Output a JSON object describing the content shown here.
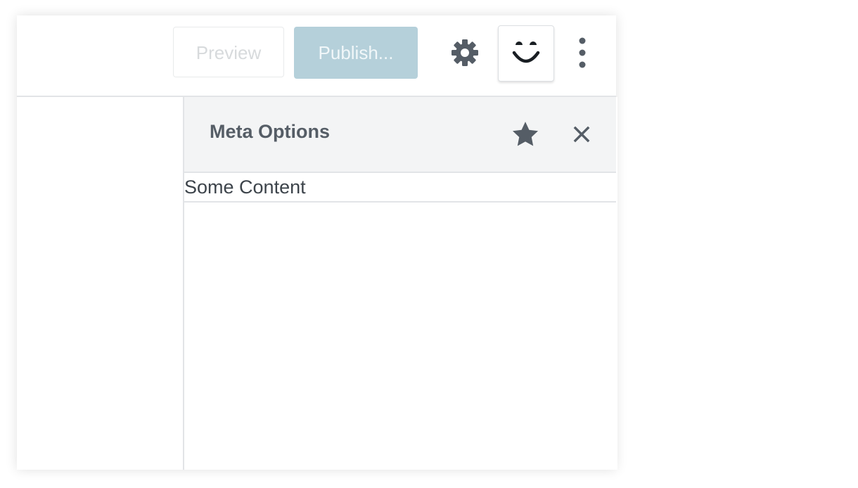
{
  "toolbar": {
    "preview_label": "Preview",
    "publish_label": "Publish...",
    "settings_icon": "gear-icon",
    "plugin_icon": "smiley-icon",
    "more_icon": "more-vertical-icon"
  },
  "sidebar": {
    "title": "Meta Options",
    "star_icon": "star-icon",
    "close_icon": "close-icon",
    "content": "Some Content"
  },
  "colors": {
    "accent_disabled": "#b5d0da",
    "icon": "#555d66",
    "border": "#e2e4e7",
    "header_bg": "#f3f4f5"
  }
}
